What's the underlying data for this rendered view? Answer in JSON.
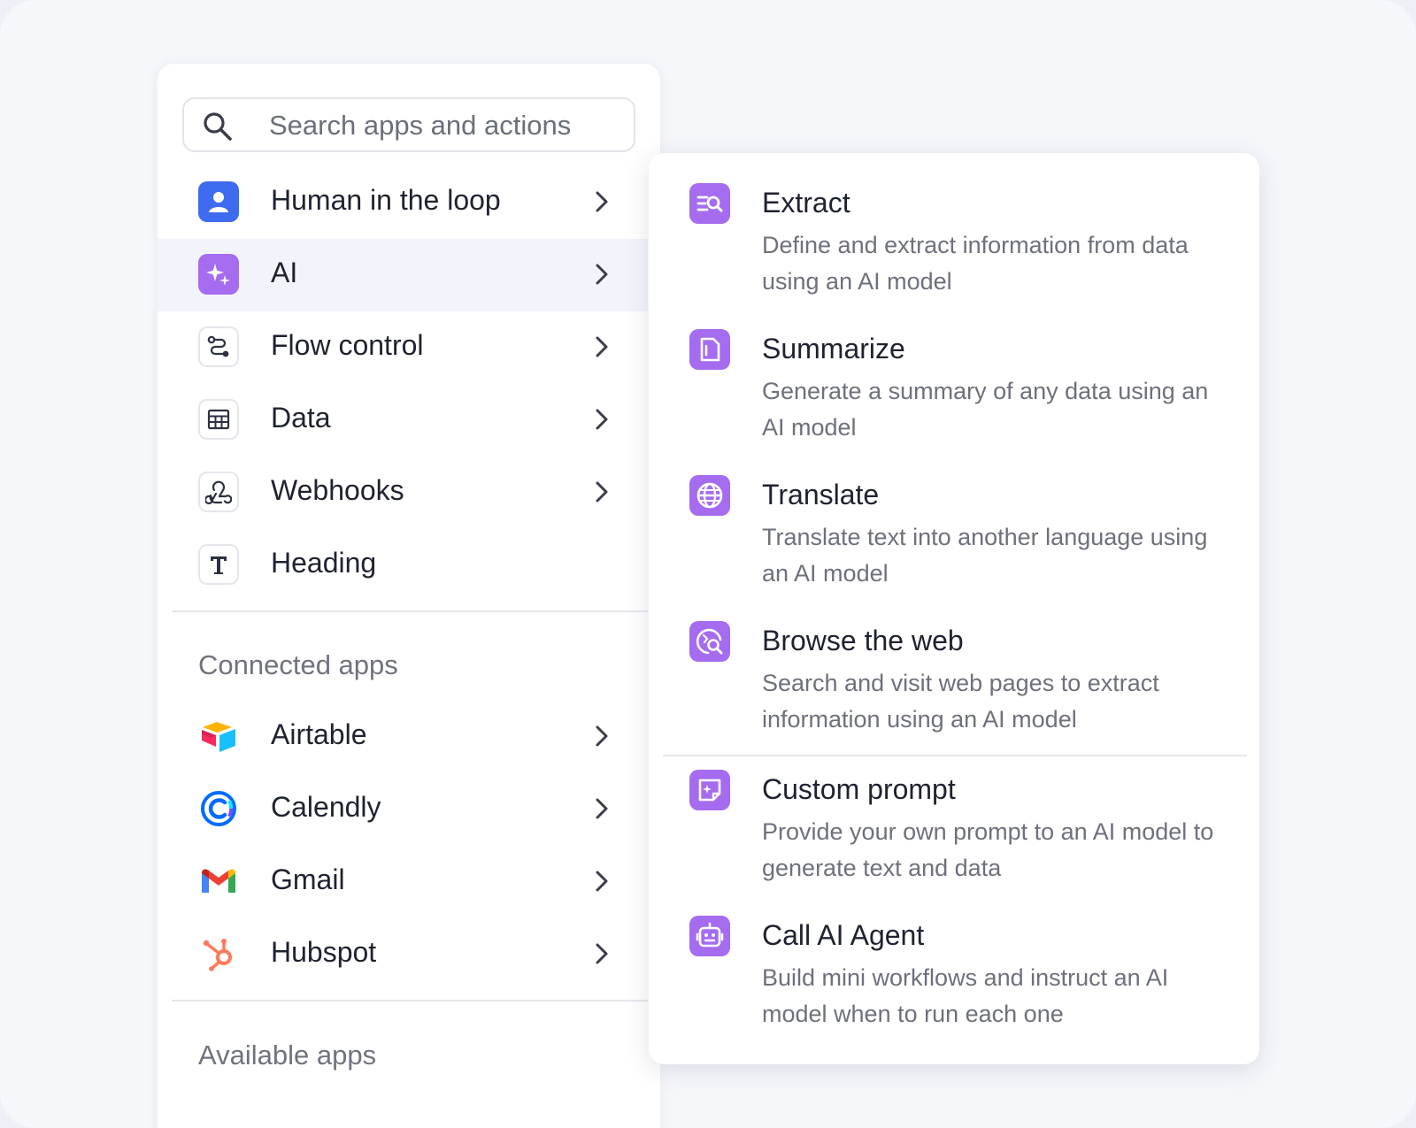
{
  "search": {
    "placeholder": "Search apps and actions"
  },
  "menu": {
    "items": [
      {
        "label": "Human in the loop",
        "icon": "person-icon",
        "has_submenu": true
      },
      {
        "label": "AI",
        "icon": "sparkles-icon",
        "has_submenu": true,
        "active": true
      },
      {
        "label": "Flow control",
        "icon": "flow-route-icon",
        "has_submenu": true
      },
      {
        "label": "Data",
        "icon": "table-icon",
        "has_submenu": true
      },
      {
        "label": "Webhooks",
        "icon": "webhook-icon",
        "has_submenu": true
      },
      {
        "label": "Heading",
        "icon": "text-t-icon",
        "has_submenu": false
      }
    ]
  },
  "connected_apps": {
    "title": "Connected apps",
    "items": [
      {
        "label": "Airtable",
        "icon": "airtable-logo-icon"
      },
      {
        "label": "Calendly",
        "icon": "calendly-logo-icon"
      },
      {
        "label": "Gmail",
        "icon": "gmail-logo-icon"
      },
      {
        "label": "Hubspot",
        "icon": "hubspot-logo-icon"
      }
    ]
  },
  "available_apps": {
    "title": "Available apps"
  },
  "ai_actions": [
    {
      "title": "Extract",
      "description": "Define and extract information from data using an AI model",
      "icon": "extract-search-icon"
    },
    {
      "title": "Summarize",
      "description": "Generate a summary of any data using an AI model",
      "icon": "document-icon"
    },
    {
      "title": "Translate",
      "description": "Translate text into another language using an AI model",
      "icon": "globe-icon"
    },
    {
      "title": "Browse the web",
      "description": "Search and visit web pages to extract information using an AI model",
      "icon": "web-search-icon"
    },
    {
      "title": "Custom prompt",
      "description": "Provide your own prompt to an AI model to generate text and data",
      "icon": "prompt-note-icon"
    },
    {
      "title": "Call AI Agent",
      "description": "Build mini workflows and instruct an AI model when to run each one",
      "icon": "robot-icon"
    }
  ],
  "colors": {
    "accent_purple": "#a56cf0",
    "accent_blue": "#3d6cf0",
    "active_row": "#f3f4fb"
  }
}
